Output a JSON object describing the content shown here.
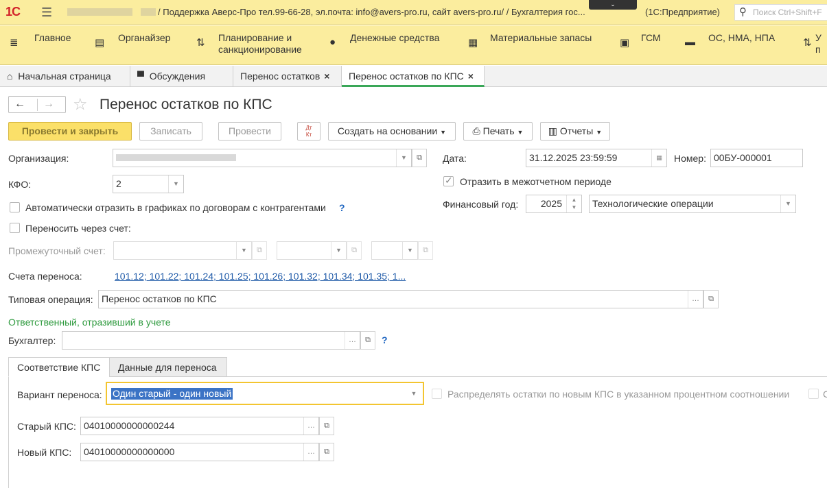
{
  "titlebar": {
    "logo": "1С",
    "title": "/ Поддержка Аверс-Про тел.99-66-28, эл.почта: info@avers-pro.ru, сайт avers-pro.ru/ / Бухгалтерия гос...",
    "app": "(1С:Предприятие)",
    "search_placeholder": "Поиск Ctrl+Shift+F"
  },
  "sections": [
    {
      "label": "Главное",
      "icon": "hamburger-icon"
    },
    {
      "label": "Органайзер",
      "icon": "clipboard-icon"
    },
    {
      "label": "Планирование и\nсанкционирование",
      "icon": "planning-icon"
    },
    {
      "label": "Денежные средства",
      "icon": "ruble-icon"
    },
    {
      "label": "Материальные запасы",
      "icon": "grid-icon"
    },
    {
      "label": "ГСМ",
      "icon": "fuel-icon"
    },
    {
      "label": "ОС, НМА, НПА",
      "icon": "truck-icon"
    },
    {
      "label": "У\nп",
      "icon": "sort-icon"
    }
  ],
  "tabs": [
    {
      "label": "Начальная страница"
    },
    {
      "label": "Обсуждения"
    },
    {
      "label": "Перенос остатков"
    },
    {
      "label": "Перенос остатков по КПС"
    }
  ],
  "form": {
    "title": "Перенос остатков по КПС",
    "toolbar": {
      "post_close": "Провести и закрыть",
      "save": "Записать",
      "post": "Провести",
      "dt_kt": "Дт Кт",
      "create_based": "Создать на основании",
      "print": "Печать",
      "reports": "Отчеты"
    },
    "org_label": "Организация:",
    "date_label": "Дата:",
    "date_value": "31.12.2025 23:59:59",
    "number_label": "Номер:",
    "number_value": "00БУ-000001",
    "kfo_label": "КФО:",
    "kfo_value": "2",
    "interperiod_label": "Отразить в межотчетном периоде",
    "auto_reflect_label": "Автоматически отразить в графиках по договорам с контрагентами",
    "fin_year_label": "Финансовый год:",
    "fin_year_value": "2025",
    "tech_ops_value": "Технологические операции",
    "transfer_via_label": "Переносить через счет:",
    "intermediate_label": "Промежуточный счет:",
    "accounts_label": "Счета переноса:",
    "accounts_value": "101.12; 101.22; 101.24; 101.25; 101.26; 101.32; 101.34; 101.35; 1...",
    "typical_op_label": "Типовая операция:",
    "typical_op_value": "Перенос остатков по КПС",
    "responsible_label": "Ответственный, отразивший в учете",
    "accountant_label": "Бухгалтер:",
    "help": "?"
  },
  "panel": {
    "tabs": [
      "Соответствие КПС",
      "Данные для переноса"
    ],
    "variant_label": "Вариант переноса:",
    "variant_value": "Один старый - один новый",
    "distribute_label": "Распределять остатки по новым КПС в указанном процентном соотношении",
    "distribute_tail": "С",
    "old_kps_label": "Старый КПС:",
    "old_kps_value": "04010000000000244",
    "new_kps_label": "Новый КПС:",
    "new_kps_value": "04010000000000000"
  },
  "colors": {
    "yellow": "#fbed9e",
    "accent_green": "#3aa758",
    "link": "#1f5aa8",
    "focus": "#f3c530"
  }
}
